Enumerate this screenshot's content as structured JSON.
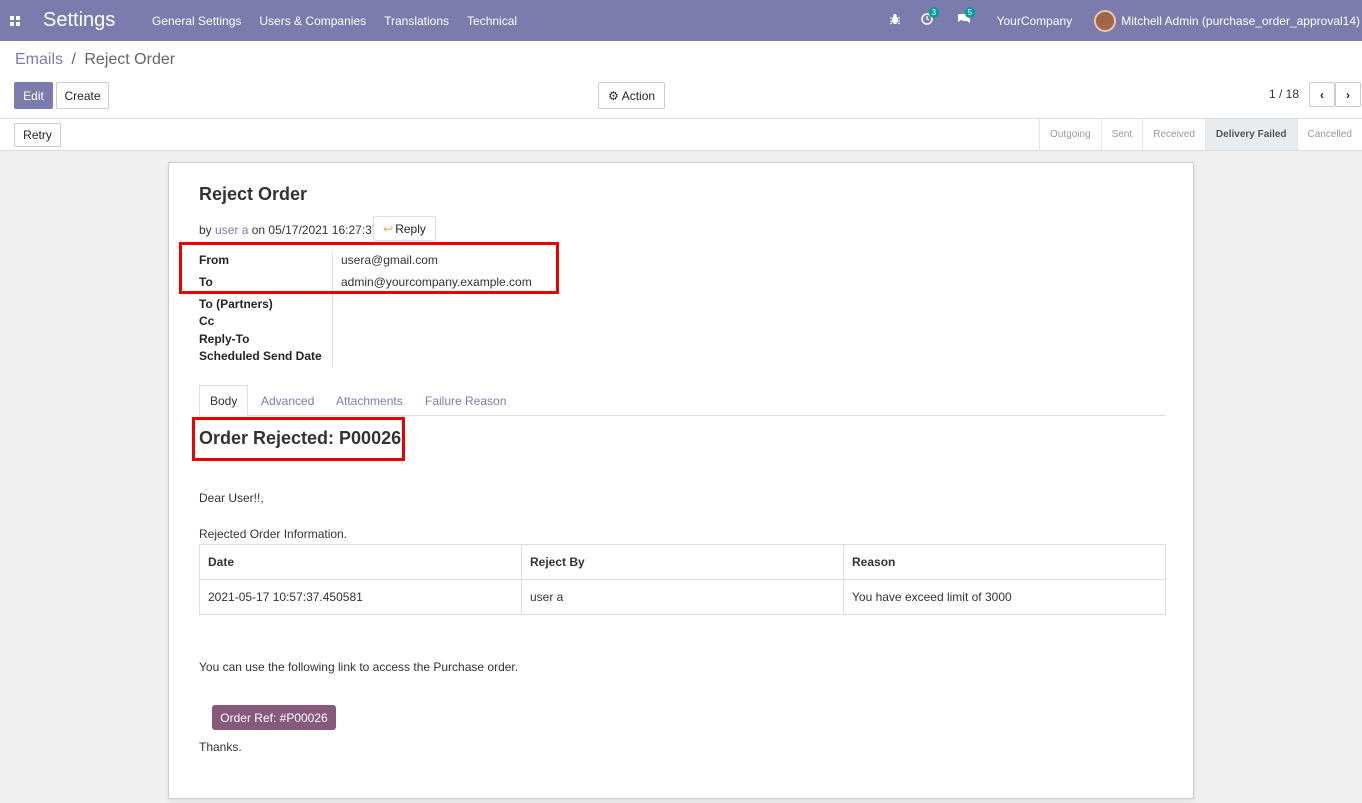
{
  "navbar": {
    "app_title": "Settings",
    "menu": [
      "General Settings",
      "Users & Companies",
      "Translations",
      "Technical"
    ],
    "activity_count": "3",
    "messages_count": "5",
    "company": "YourCompany",
    "user": "Mitchell Admin (purchase_order_approval14)"
  },
  "breadcrumb": {
    "parent": "Emails",
    "separator": "/",
    "current": "Reject Order"
  },
  "buttons": {
    "edit": "Edit",
    "create": "Create",
    "action": "Action",
    "retry": "Retry"
  },
  "pager": {
    "text": "1 / 18"
  },
  "stages": [
    "Outgoing",
    "Sent",
    "Received",
    "Delivery Failed",
    "Cancelled"
  ],
  "active_stage": "Delivery Failed",
  "email": {
    "subject": "Reject Order",
    "by_prefix": "by",
    "author": "user a",
    "on_date": "on 05/17/2021 16:27:37",
    "reply_label": "Reply",
    "fields": {
      "from_label": "From",
      "from_value": "usera@gmail.com",
      "to_label": "To",
      "to_value": "admin@yourcompany.example.com",
      "to_partners_label": "To (Partners)",
      "cc_label": "Cc",
      "reply_to_label": "Reply-To",
      "scheduled_label": "Scheduled Send Date"
    },
    "tabs": [
      "Body",
      "Advanced",
      "Attachments",
      "Failure Reason"
    ],
    "body": {
      "heading": "Order Rejected: P00026",
      "greeting": "Dear User!!,",
      "info_intro": "Rejected Order Information.",
      "table_headers": [
        "Date",
        "Reject By",
        "Reason"
      ],
      "table_row": [
        "2021-05-17 10:57:37.450581",
        "user a",
        "You have exceed limit of 3000"
      ],
      "link_text": "You can use the following link to access the Purchase order.",
      "order_ref": "Order Ref: #P00026",
      "closing": "Thanks."
    }
  },
  "colors": {
    "navbar": "#7c7bad",
    "primary": "#7c7bad",
    "order_ref_button": "#875a7b",
    "highlight": "#ee0000"
  }
}
